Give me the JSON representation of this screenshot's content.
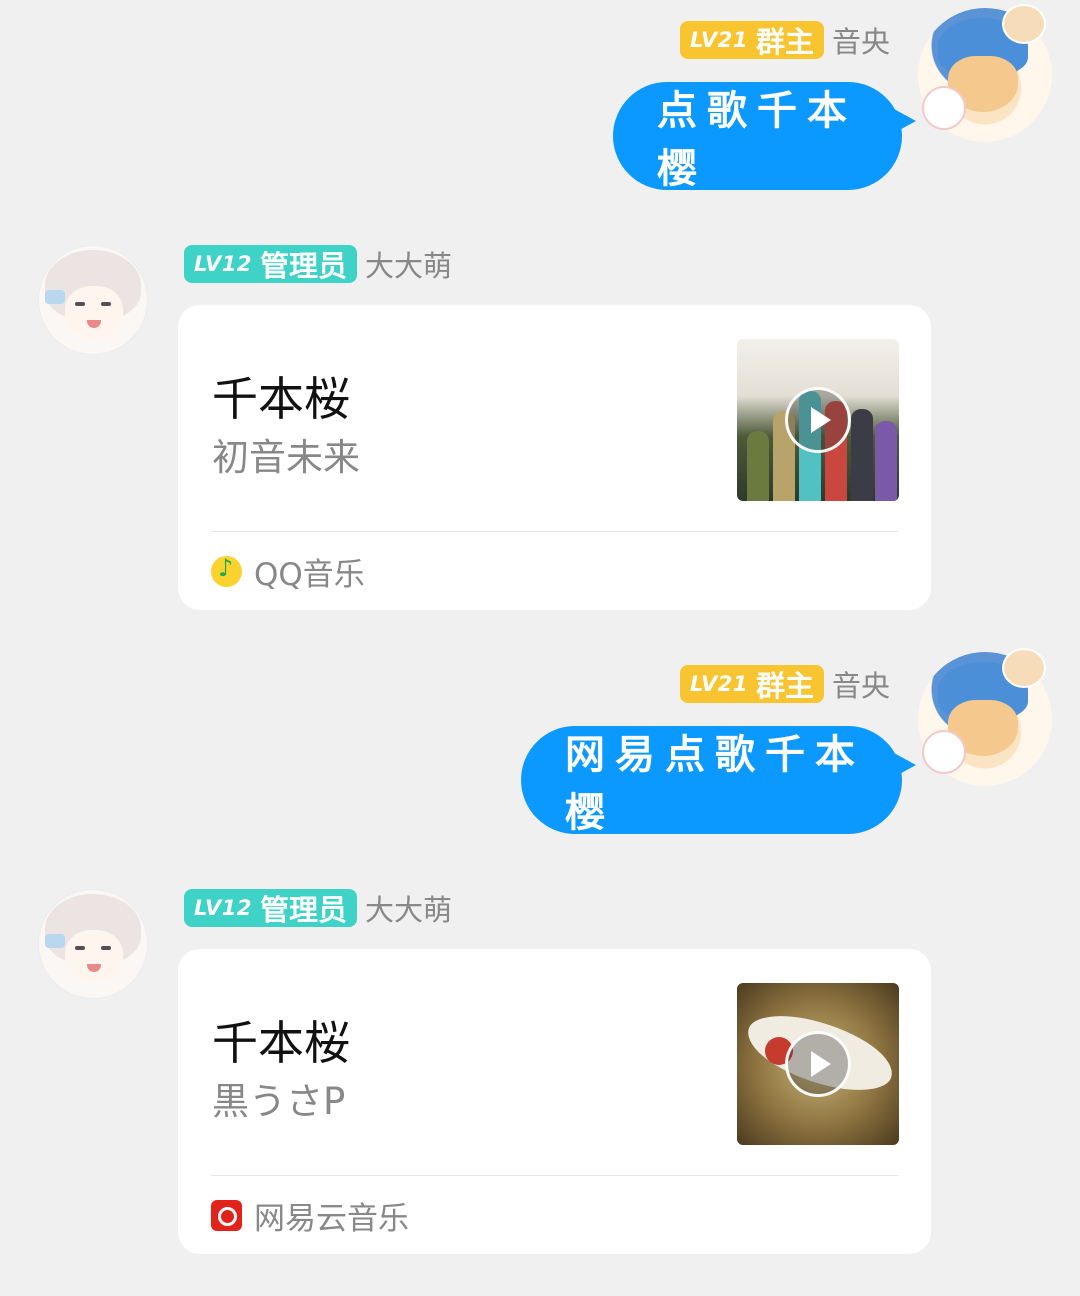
{
  "messages": [
    {
      "type": "text",
      "side": "right",
      "badge": {
        "level": "LV21",
        "role": "群主",
        "color": "#f8c42f"
      },
      "sender": "音央",
      "text": "点歌千本樱"
    },
    {
      "type": "music",
      "side": "left",
      "badge": {
        "level": "LV12",
        "role": "管理员",
        "color": "#3fd2c6"
      },
      "sender": "大大萌",
      "song": "千本桜",
      "artist": "初音未来",
      "source": "QQ音乐",
      "source_icon": "qq-music-icon"
    },
    {
      "type": "text",
      "side": "right",
      "badge": {
        "level": "LV21",
        "role": "群主",
        "color": "#f8c42f"
      },
      "sender": "音央",
      "text": "网易点歌千本樱"
    },
    {
      "type": "music",
      "side": "left",
      "badge": {
        "level": "LV12",
        "role": "管理员",
        "color": "#3fd2c6"
      },
      "sender": "大大萌",
      "song": "千本桜",
      "artist": "黒うさP",
      "source": "网易云音乐",
      "source_icon": "netease-music-icon"
    }
  ],
  "colors": {
    "bubble": "#0b99ff",
    "background": "#f0f0f0",
    "card": "#ffffff"
  }
}
